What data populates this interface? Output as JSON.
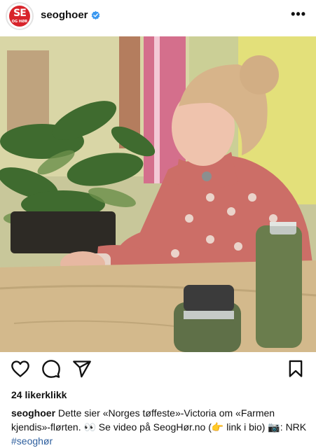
{
  "post": {
    "username": "seoghoer",
    "avatar_text_big": "SE",
    "avatar_text_small": "OG HØR",
    "more_icon": "more-icon",
    "likes": "24 likerklikk",
    "caption": {
      "user": "seoghoer",
      "text": " Dette sier «Norges tøffeste»-Victoria om «Farmen kjendis»-flørten. 👀 Se video på SeogHør.no (👉 link i bio) 📷: NRK ",
      "hashtag": "#seoghør"
    }
  },
  "colors": {
    "brand_red": "#d8232a",
    "verified_blue": "#3897f0",
    "hashtag_blue": "#2e5f9e"
  },
  "icons": [
    "like-heart-icon",
    "comment-icon",
    "share-icon",
    "bookmark-icon",
    "verified-badge-icon"
  ]
}
